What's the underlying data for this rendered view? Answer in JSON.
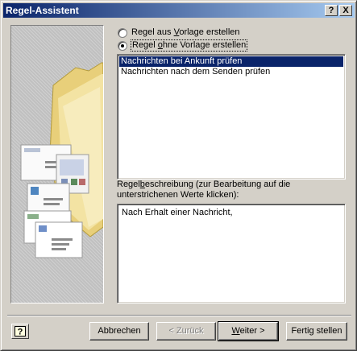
{
  "window": {
    "title": "Regel-Assistent",
    "help_glyph": "?",
    "close_glyph": "X"
  },
  "options": {
    "from_template": {
      "pre": "Regel aus ",
      "accel": "V",
      "post": "orlage erstellen",
      "checked": false
    },
    "blank_rule": {
      "pre": "Regel ",
      "accel": "o",
      "post": "hne Vorlage erstellen",
      "checked": true
    }
  },
  "rule_list": [
    {
      "label": "Nachrichten bei Ankunft prüfen",
      "selected": true
    },
    {
      "label": "Nachrichten nach dem Senden prüfen",
      "selected": false
    }
  ],
  "description": {
    "label_pre": "Regel",
    "label_accel": "b",
    "label_post": "eschreibung (zur Bearbeitung auf die unterstrichenen Werte klicken):",
    "text": "Nach Erhalt einer Nachricht,"
  },
  "buttons": {
    "cancel": "Abbrechen",
    "back": "< Zurück",
    "next_accel": "W",
    "next_rest": "eiter >",
    "finish": "Fertig stellen"
  },
  "icons": {
    "help_icon": "question-mark-box",
    "illustration": "folder-and-envelopes"
  }
}
